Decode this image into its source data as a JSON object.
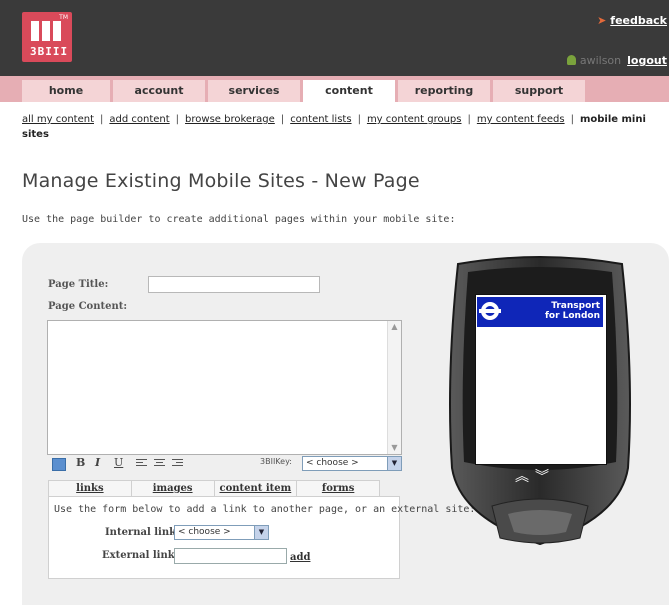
{
  "header": {
    "logo_text": "3BIII",
    "logo_tm": "TM",
    "feedback_label": "feedback",
    "username": "awilson",
    "logout_label": "logout",
    "brand_color": "#d94a5a"
  },
  "nav": {
    "tabs": [
      "home",
      "account",
      "services",
      "content",
      "reporting",
      "support"
    ],
    "active": "content"
  },
  "subnav": {
    "items": [
      "all my content",
      "add content",
      "browse brokerage",
      "content lists",
      "my content groups",
      "my content feeds"
    ],
    "current": "mobile mini sites"
  },
  "page": {
    "title": "Manage Existing Mobile Sites - New Page",
    "intro": "Use the page builder to create additional pages within your mobile site:"
  },
  "form": {
    "page_title_label": "Page Title:",
    "page_title_value": "",
    "page_content_label": "Page Content:",
    "page_content_value": "",
    "toolbar": {
      "bold": "B",
      "italic": "I",
      "underline": "U",
      "bbkey_label": "3BIIKey:",
      "bbkey_value": "< choose >"
    },
    "link_tabs": [
      "links",
      "images",
      "content item",
      "forms"
    ],
    "links": {
      "help": "Use the form below to add a link to another page, or an external site:",
      "internal_label": "Internal link:",
      "internal_value": "< choose >",
      "external_label": "External link:",
      "external_value": "",
      "add_label": "add"
    }
  },
  "preview": {
    "logo_line1": "Transport",
    "logo_line2": "for London",
    "logo_color": "#0f26b8"
  }
}
